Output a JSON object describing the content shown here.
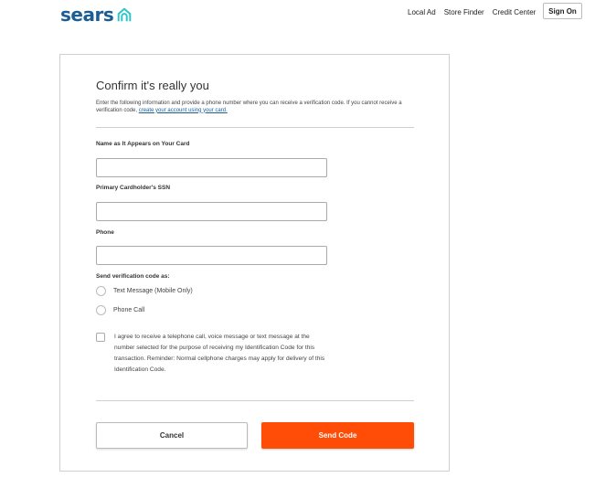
{
  "header": {
    "logo_text": "sears",
    "brand_color": "#1c5d96",
    "logo_icon": "house-icon",
    "nav": [
      {
        "label": "Local Ad"
      },
      {
        "label": "Store Finder"
      },
      {
        "label": "Credit Center"
      }
    ],
    "sign_on_label": "Sign On"
  },
  "form": {
    "title": "Confirm it's really you",
    "intro_text": "Enter the following information and provide a phone number where you can receive a verification code. If you cannot receive a verification code,",
    "intro_link": "create your account using your card.",
    "fields": {
      "name": {
        "label": "Name as It Appears on Your Card",
        "value": "",
        "placeholder": ""
      },
      "ssn": {
        "label": "Primary Cardholder's SSN",
        "value": "",
        "placeholder": ""
      },
      "phone": {
        "label": "Phone",
        "value": "",
        "placeholder": ""
      }
    },
    "send_label": "Send verification code as:",
    "options": [
      {
        "label": "Text Message (Mobile Only)",
        "selected": false
      },
      {
        "label": "Phone Call",
        "selected": false
      }
    ],
    "agree_text": "I agree to receive a telephone call, voice message or text message at the number selected for the purpose of receiving my Identification Code for this transaction. Reminder: Normal cellphone charges may apply for delivery of this Identification Code.",
    "agree_checked": false,
    "cancel_label": "Cancel",
    "send_code_label": "Send Code",
    "accent_color": "#ff4c06"
  }
}
